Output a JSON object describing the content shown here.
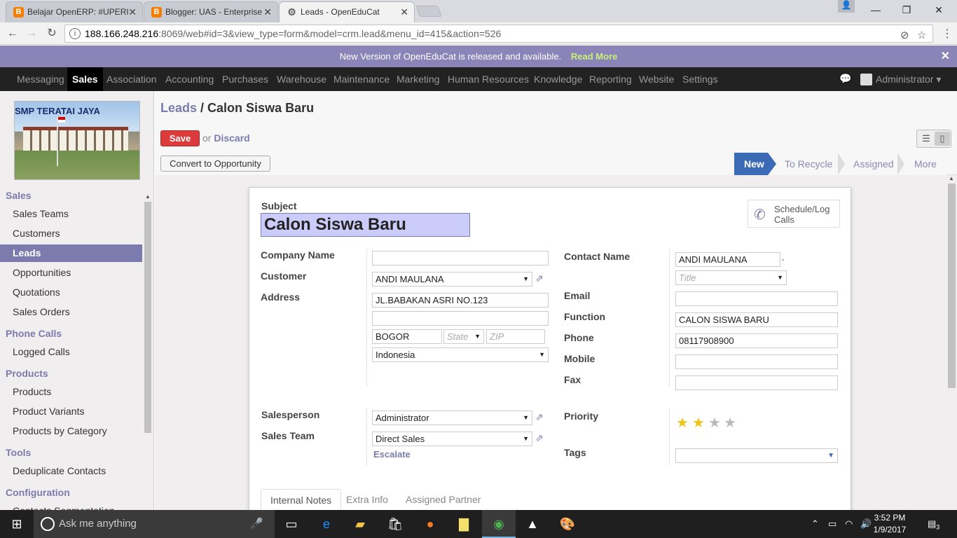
{
  "browser": {
    "tabs": [
      {
        "label": "Belajar OpenERP: #UPERI",
        "icon": "blogger-icon"
      },
      {
        "label": "Blogger: UAS - Enterprise",
        "icon": "blogger-icon"
      },
      {
        "label": "Leads - OpenEduCat",
        "icon": "odoo-icon"
      }
    ],
    "url_host": "188.166.248.216",
    "url_rest": ":8069/web#id=3&view_type=form&model=crm.lead&menu_id=415&action=526"
  },
  "announcement": {
    "text": "New Version of OpenEduCat is released and available.",
    "link": "Read More"
  },
  "topmenu": {
    "items": [
      "Messaging",
      "Sales",
      "Association",
      "Accounting",
      "Purchases",
      "Warehouse",
      "Maintenance",
      "Marketing",
      "Human Resources",
      "Knowledge",
      "Reporting",
      "Website",
      "Settings"
    ],
    "active": "Sales",
    "user": "Administrator"
  },
  "sidebar": {
    "logo_text": "SMP TERATAI JAYA",
    "sections": [
      {
        "title": "Sales",
        "items": [
          "Sales Teams",
          "Customers",
          "Leads",
          "Opportunities",
          "Quotations",
          "Sales Orders"
        ]
      },
      {
        "title": "Phone Calls",
        "items": [
          "Logged Calls"
        ]
      },
      {
        "title": "Products",
        "items": [
          "Products",
          "Product Variants",
          "Products by Category"
        ]
      },
      {
        "title": "Tools",
        "items": [
          "Deduplicate Contacts"
        ]
      },
      {
        "title": "Configuration",
        "items": [
          "Contacts Segmentation"
        ]
      }
    ],
    "active_item": "Leads"
  },
  "control_panel": {
    "breadcrumb_parent": "Leads",
    "breadcrumb_sep": " / ",
    "breadcrumb_current": "Calon Siswa Baru",
    "save": "Save",
    "or": "or",
    "discard": "Discard",
    "convert": "Convert to Opportunity",
    "stages": [
      "New",
      "To Recycle",
      "Assigned",
      "More"
    ],
    "current_stage": "New"
  },
  "form": {
    "subject_label": "Subject",
    "subject": "Calon Siswa Baru",
    "schedule": "Schedule/Log Calls",
    "left": {
      "company_label": "Company Name",
      "company": "",
      "customer_label": "Customer",
      "customer": "ANDI MAULANA",
      "address_label": "Address",
      "street": "JL.BABAKAN ASRI NO.123",
      "street2": "",
      "city": "BOGOR",
      "state_ph": "State",
      "zip_ph": "ZIP",
      "country": "Indonesia",
      "salesperson_label": "Salesperson",
      "salesperson": "Administrator",
      "team_label": "Sales Team",
      "team": "Direct Sales",
      "escalate": "Escalate"
    },
    "right": {
      "contact_label": "Contact Name",
      "contact": "ANDI MAULANA",
      "comma": ",",
      "title_ph": "Title",
      "email_label": "Email",
      "email": "",
      "function_label": "Function",
      "function": "CALON SISWA BARU",
      "phone_label": "Phone",
      "phone": "08117908900",
      "mobile_label": "Mobile",
      "mobile": "",
      "fax_label": "Fax",
      "fax": "",
      "priority_label": "Priority",
      "priority": 2,
      "priority_max": 4,
      "tags_label": "Tags"
    },
    "tabs": [
      "Internal Notes",
      "Extra Info",
      "Assigned Partner"
    ],
    "active_tab": "Internal Notes"
  },
  "taskbar": {
    "search": "Ask me anything",
    "time": "3:52 PM",
    "date": "1/9/2017",
    "notifications": "3"
  },
  "colors": {
    "brand": "#7c7bad",
    "announce_bg": "#8a84b8",
    "save": "#dc3b3b",
    "stage_active": "#3b6bb5"
  }
}
